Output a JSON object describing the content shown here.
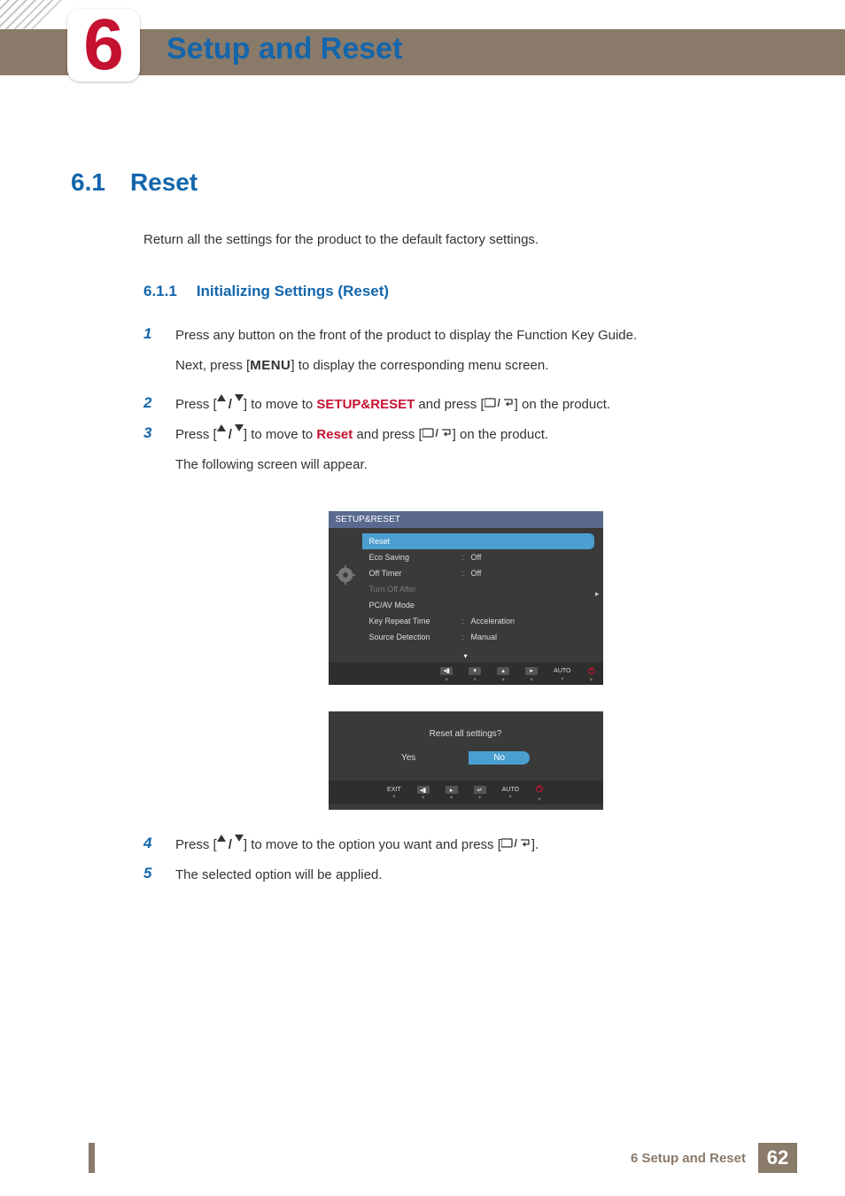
{
  "chapter": {
    "number": "6",
    "title": "Setup and Reset"
  },
  "section": {
    "number": "6.1",
    "title": "Reset",
    "desc": "Return all the settings for the product to the default factory settings."
  },
  "subsection": {
    "number": "6.1.1",
    "title": "Initializing Settings (Reset)"
  },
  "steps": {
    "s1": {
      "num": "1",
      "line1": "Press any button on the front of the product to display the Function Key Guide.",
      "line2a": "Next, press [",
      "menu": "MENU",
      "line2b": "] to display the corresponding menu screen."
    },
    "s2": {
      "num": "2",
      "a": "Press [",
      "b": "] to move to ",
      "hl": "SETUP&RESET",
      "c": " and press [",
      "d": "] on the product."
    },
    "s3": {
      "num": "3",
      "a": "Press [",
      "b": "] to move to ",
      "hl": "Reset",
      "c": " and press [",
      "d": "] on the product.",
      "sub": "The following screen will appear."
    },
    "s4": {
      "num": "4",
      "a": "Press [",
      "b": "] to move to the option you want and press [",
      "c": "]."
    },
    "s5": {
      "num": "5",
      "a": "The selected option will be applied."
    }
  },
  "osd1": {
    "title": "SETUP&RESET",
    "rows": [
      {
        "label": "Reset",
        "value": "",
        "selected": true
      },
      {
        "label": "Eco Saving",
        "value": "Off"
      },
      {
        "label": "Off Timer",
        "value": "Off"
      },
      {
        "label": "Turn Off After",
        "value": "",
        "dim": true
      },
      {
        "label": "PC/AV Mode",
        "value": ""
      },
      {
        "label": "Key Repeat Time",
        "value": "Acceleration"
      },
      {
        "label": "Source Detection",
        "value": "Manual"
      }
    ],
    "footer_auto": "AUTO"
  },
  "osd2": {
    "question": "Reset all settings?",
    "yes": "Yes",
    "no": "No",
    "exit": "EXIT",
    "auto": "AUTO"
  },
  "footer": {
    "text": "6 Setup and Reset",
    "page": "62"
  }
}
